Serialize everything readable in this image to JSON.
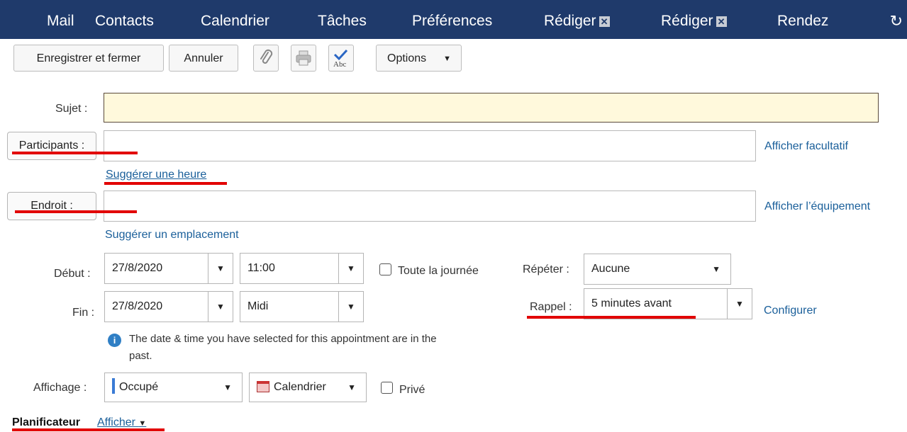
{
  "tabs": [
    {
      "label": "Mail",
      "closable": false
    },
    {
      "label": "Contacts",
      "closable": false
    },
    {
      "label": "Calendrier",
      "closable": false
    },
    {
      "label": "Tâches",
      "closable": false
    },
    {
      "label": "Préférences",
      "closable": false
    },
    {
      "label": "Rédiger",
      "closable": true
    },
    {
      "label": "Rédiger",
      "closable": true
    },
    {
      "label": "Rendez",
      "closable": false
    }
  ],
  "tab_close_glyph": "✕",
  "refresh_glyph": "↻",
  "toolbar": {
    "save_close": "Enregistrer et fermer",
    "cancel": "Annuler",
    "options": "Options"
  },
  "form": {
    "subject_label": "Sujet :",
    "subject_value": "",
    "participants_label": "Participants :",
    "participants_value": "",
    "show_optional": "Afficher facultatif",
    "suggest_time": "Suggérer une heure",
    "location_label": "Endroit :",
    "location_value": "",
    "show_equipment": "Afficher l’équipement",
    "suggest_location": "Suggérer un emplacement",
    "start_label": "Début :",
    "start_date": "27/8/2020",
    "start_time": "11:00",
    "all_day": "Toute la journée",
    "repeat_label": "Répéter :",
    "repeat_value": "Aucune",
    "end_label": "Fin :",
    "end_date": "27/8/2020",
    "end_time": "Midi",
    "reminder_label": "Rappel :",
    "reminder_value": "5 minutes avant",
    "configure": "Configurer",
    "info_line1": "The date & time you have selected for this appointment are in the",
    "info_line2": "past.",
    "display_label": "Affichage :",
    "display_value": "Occupé",
    "calendar_value": "Calendrier",
    "private": "Privé"
  },
  "scheduler": {
    "title": "Planificateur",
    "show": "Afficher"
  },
  "colors": {
    "topbar": "#1f3a6b",
    "link": "#1a5f9a",
    "subject_bg": "#fff9dc",
    "annotation": "#e20000",
    "busy": "#3a7bd5"
  }
}
